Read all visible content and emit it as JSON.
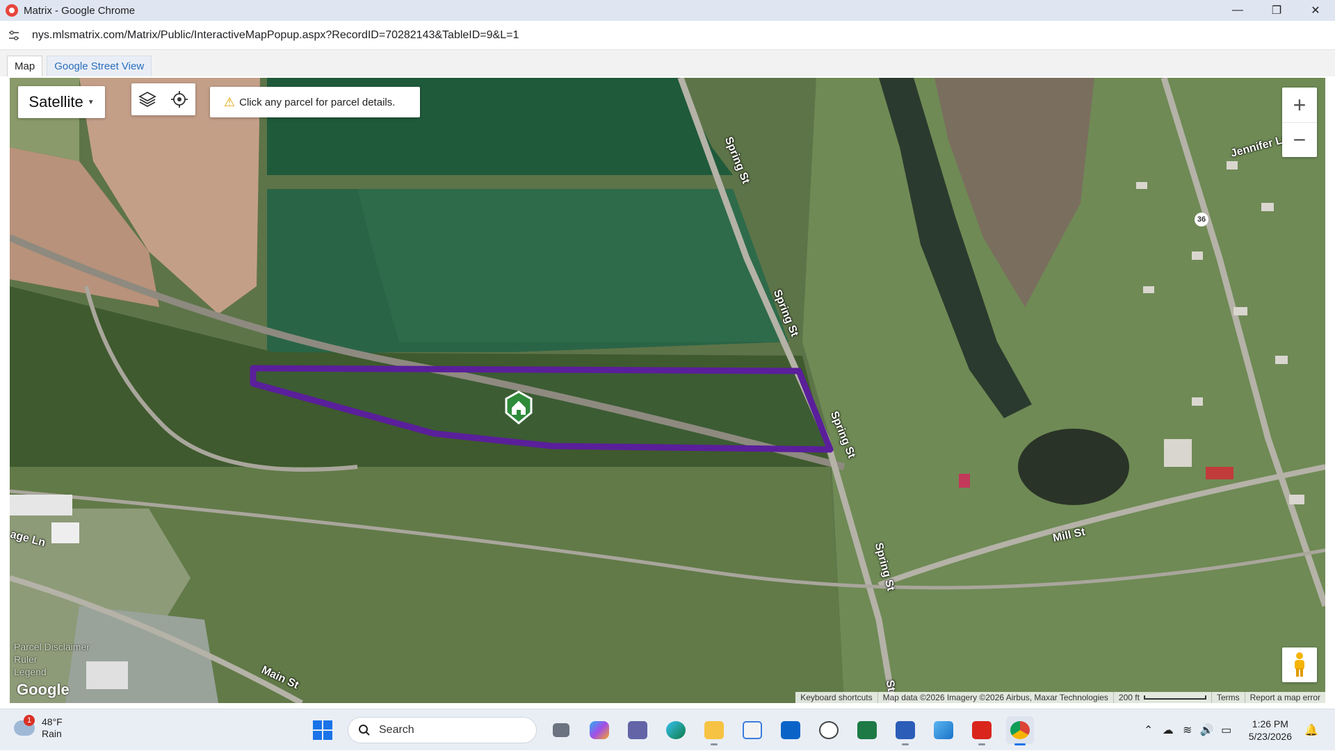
{
  "window": {
    "title": "Matrix - Google Chrome",
    "controls": [
      "—",
      "❐",
      "✕"
    ]
  },
  "address_bar": {
    "url": "nys.mlsmatrix.com/Matrix/Public/InteractiveMapPopup.aspx?RecordID=70282143&TableID=9&L=1"
  },
  "page_tabs": [
    {
      "label": "Map",
      "active": true
    },
    {
      "label": "Google Street View",
      "active": false
    }
  ],
  "map": {
    "map_type_label": "Satellite",
    "notice_text": "Click any parcel for parcel details.",
    "zoom_in": "+",
    "zoom_out": "−",
    "road_labels": {
      "spring_st_1": "Spring St",
      "spring_st_2": "Spring St",
      "spring_st_3": "Spring St",
      "spring_st_4": "Spring St",
      "spring_st_5": "St",
      "mill_st": "Mill St",
      "main_st": "Main St",
      "jennifer_ln": "Jennifer Ln",
      "age_ln": "age Ln",
      "route_36": "36"
    },
    "left_links": [
      "Parcel Disclaimer",
      "Ruler",
      "Legend"
    ],
    "google_logo": "Google",
    "attribution": {
      "keyboard_shortcuts": "Keyboard shortcuts",
      "map_data": "Map data ©2026 Imagery ©2026 Airbus, Maxar Technologies",
      "scale": "200 ft",
      "terms": "Terms",
      "report": "Report a map error"
    },
    "colors": {
      "parcel_outline": "#5a1f9a",
      "marker": "#2e8b3a"
    }
  },
  "taskbar": {
    "weather_temp": "48°F",
    "weather_desc": "Rain",
    "weather_badge": "1",
    "search_placeholder": "Search",
    "apps": [
      "task-view",
      "copilot",
      "teams",
      "edge",
      "file-explorer",
      "store",
      "outlook",
      "dell",
      "excel",
      "word",
      "photos",
      "acrobat",
      "chrome"
    ],
    "clock_time": "1:26 PM",
    "clock_date": "5/23/2026"
  }
}
